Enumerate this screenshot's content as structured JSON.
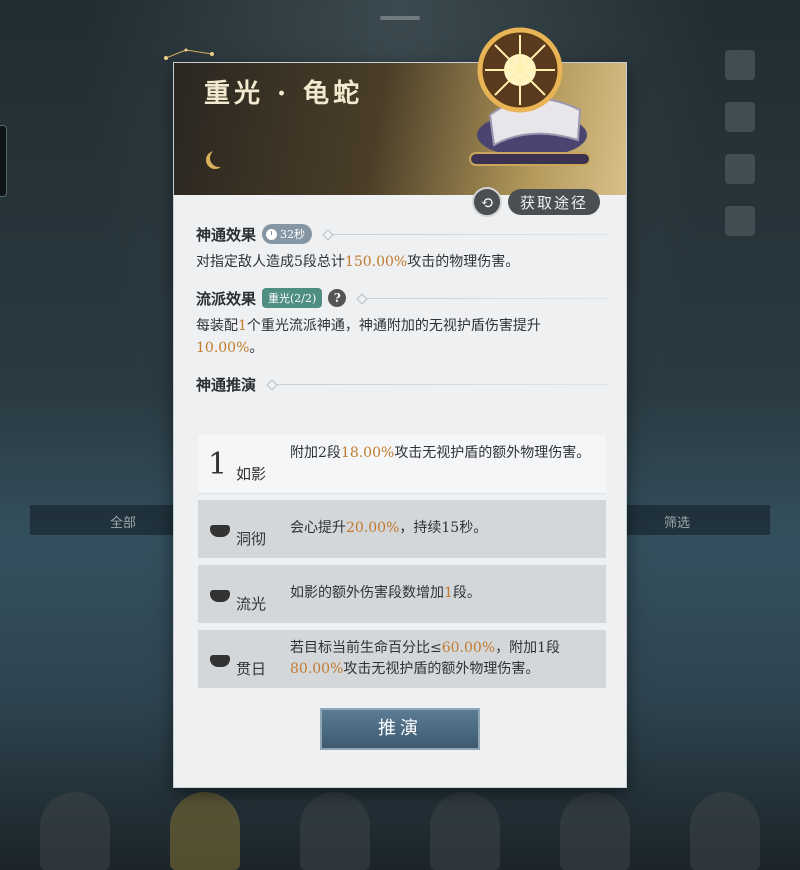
{
  "panel": {
    "title": "重光 · 龟蛇",
    "acquire_label": "获取途径",
    "icons": [
      "moon-icon",
      "refresh-icon",
      "emblem-icon"
    ]
  },
  "effect": {
    "title": "神通效果",
    "cooldown": "32秒",
    "desc_pre": "对指定敌人造成5段总计",
    "desc_hl": "150.00%",
    "desc_post": "攻击的物理伤害。"
  },
  "school": {
    "title": "流派效果",
    "badge": "重光(2/2)",
    "help": "?",
    "desc_pre": "每装配",
    "desc_hl1": "1",
    "desc_mid": "个重光流派神通，神通附加的无视护盾伤害提升",
    "desc_hl2": "10.00%",
    "desc_post": "。"
  },
  "deduction": {
    "title": "神通推演",
    "nodes": [
      {
        "num": "1",
        "name": "如影",
        "pre": "附加2段",
        "hl": "18.00%",
        "post": "攻击无视护盾的额外物理伤害。"
      },
      {
        "name": "洞彻",
        "pre": "会心提升",
        "hl": "20.00%",
        "post": "，持续15秒。"
      },
      {
        "name": "流光",
        "pre": "如影的额外伤害段数增加",
        "hl": "1",
        "post": "段。"
      },
      {
        "name": "贯日",
        "pre": "若目标当前生命百分比≤",
        "hl": "60.00%",
        "mid": "，附加1段",
        "hl2": "80.00%",
        "post": "攻击无视护盾的额外物理伤害。"
      }
    ],
    "button": "推演"
  },
  "background": {
    "band_left": "全部",
    "band_right": "筛选"
  },
  "colors": {
    "highlight": "#c27a2c",
    "school_badge": "#4f8e83",
    "button": "#3d5a71"
  }
}
